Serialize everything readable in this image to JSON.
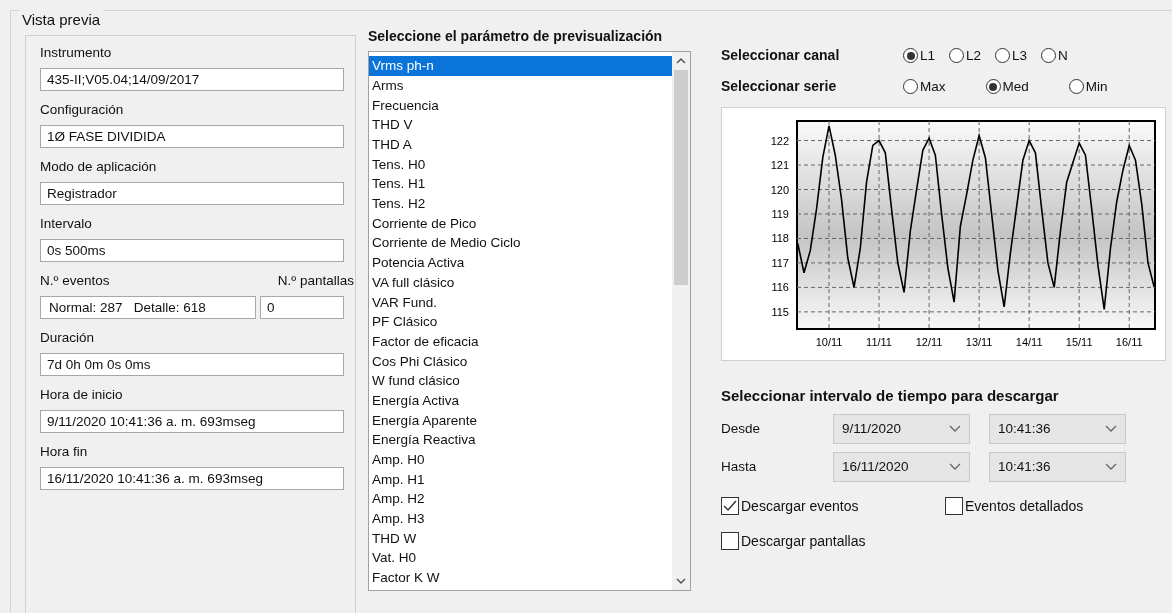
{
  "group_title": "Vista previa",
  "info_fields": [
    {
      "kind": "text",
      "label": "Instrumento",
      "value": "435-II;V05.04;14/09/2017"
    },
    {
      "kind": "text",
      "label": "Configuración",
      "value": "1Ø FASE DIVIDIDA"
    },
    {
      "kind": "text",
      "label": "Modo de aplicación",
      "value": "Registrador"
    },
    {
      "kind": "text",
      "label": "Intervalo",
      "value": "0s 500ms"
    },
    {
      "kind": "pair",
      "label": "N.º eventos",
      "value": "Normal: 287   Detalle: 618",
      "label_2": "N.º pantallas",
      "value_2": "0"
    },
    {
      "kind": "text",
      "label": "Duración",
      "value": "7d 0h 0m 0s 0ms"
    },
    {
      "kind": "text",
      "label": "Hora de inicio",
      "value": "9/11/2020 10:41:36 a. m. 693mseg"
    },
    {
      "kind": "text",
      "label": "Hora fin",
      "value": "16/11/2020 10:41:36 a. m. 693mseg"
    }
  ],
  "parameter_list": {
    "title": "Seleccione el parámetro de previsualización",
    "items": [
      {
        "label": "Vrms ph-n",
        "selected": true
      },
      {
        "label": "Arms",
        "selected": false
      },
      {
        "label": "Frecuencia",
        "selected": false
      },
      {
        "label": "THD V",
        "selected": false
      },
      {
        "label": "THD A",
        "selected": false
      },
      {
        "label": "Tens. H0",
        "selected": false
      },
      {
        "label": "Tens. H1",
        "selected": false
      },
      {
        "label": "Tens. H2",
        "selected": false
      },
      {
        "label": "Corriente de Pico",
        "selected": false
      },
      {
        "label": "Corriente de Medio Ciclo",
        "selected": false
      },
      {
        "label": "Potencia Activa",
        "selected": false
      },
      {
        "label": "VA full clásico",
        "selected": false
      },
      {
        "label": "VAR Fund.",
        "selected": false
      },
      {
        "label": "PF Clásico",
        "selected": false
      },
      {
        "label": "Factor de eficacia",
        "selected": false
      },
      {
        "label": "Cos Phi Clásico",
        "selected": false
      },
      {
        "label": "W fund clásico",
        "selected": false
      },
      {
        "label": "Energía Activa",
        "selected": false
      },
      {
        "label": "Energía Aparente",
        "selected": false
      },
      {
        "label": "Energía Reactiva",
        "selected": false
      },
      {
        "label": "Amp. H0",
        "selected": false
      },
      {
        "label": "Amp. H1",
        "selected": false
      },
      {
        "label": "Amp. H2",
        "selected": false
      },
      {
        "label": "Amp. H3",
        "selected": false
      },
      {
        "label": "THD W",
        "selected": false
      },
      {
        "label": "Vat. H0",
        "selected": false
      },
      {
        "label": "Factor K W",
        "selected": false
      }
    ]
  },
  "channel": {
    "label": "Seleccionar canal",
    "options": [
      {
        "label": "L1",
        "selected": true
      },
      {
        "label": "L2",
        "selected": false
      },
      {
        "label": "L3",
        "selected": false
      },
      {
        "label": "N",
        "selected": false
      }
    ]
  },
  "series": {
    "label": "Seleccionar serie",
    "options": [
      {
        "label": "Max",
        "selected": false
      },
      {
        "label": "Med",
        "selected": true
      },
      {
        "label": "Min",
        "selected": false
      }
    ]
  },
  "chart_data": {
    "type": "line",
    "grid": true,
    "ylim": [
      114.3,
      122.8
    ],
    "yticks": [
      115,
      116,
      117,
      118,
      119,
      120,
      121,
      122
    ],
    "categories": [
      null,
      null,
      null,
      null,
      null,
      "10/11",
      null,
      null,
      null,
      null,
      null,
      null,
      null,
      "11/11",
      null,
      null,
      null,
      null,
      null,
      null,
      null,
      "12/11",
      null,
      null,
      null,
      null,
      null,
      null,
      null,
      "13/11",
      null,
      null,
      null,
      null,
      null,
      null,
      null,
      "14/11",
      null,
      null,
      null,
      null,
      null,
      null,
      null,
      "15/11",
      null,
      null,
      null,
      null,
      null,
      null,
      null,
      "16/11",
      null,
      null,
      null,
      null
    ],
    "series": [
      {
        "color": "#000000",
        "values": [
          117.8,
          116.6,
          117.5,
          119.2,
          121.3,
          122.6,
          121.4,
          119.6,
          117.2,
          116,
          117.6,
          120.3,
          121.8,
          122,
          121.5,
          119.2,
          117,
          115.8,
          118.3,
          120,
          121.6,
          122.1,
          121.4,
          119,
          116.8,
          115.4,
          118.5,
          119.8,
          121.2,
          122.2,
          121.3,
          119,
          116.7,
          115.2,
          117.4,
          119.3,
          121.2,
          122,
          121.5,
          119.2,
          117,
          116,
          118.3,
          120.3,
          121.1,
          121.9,
          121.4,
          119.2,
          116.9,
          115.1,
          117.6,
          119.5,
          120.8,
          121.8,
          121.2,
          119.4,
          117,
          116
        ]
      }
    ]
  },
  "download_interval": {
    "title": "Seleccionar intervalo de tiempo para descargar",
    "rows": [
      {
        "label": "Desde",
        "date": "9/11/2020",
        "time": "10:41:36"
      },
      {
        "label": "Hasta",
        "date": "16/11/2020",
        "time": "10:41:36"
      }
    ]
  },
  "checkboxes": [
    {
      "label": "Descargar eventos",
      "checked": true
    },
    {
      "label": "Eventos detallados",
      "checked": false
    },
    {
      "label": "Descargar pantallas",
      "checked": false
    }
  ]
}
